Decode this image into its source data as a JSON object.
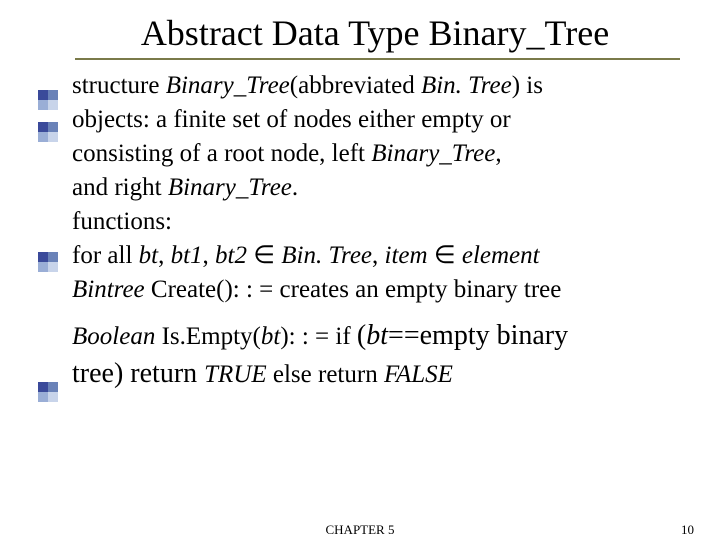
{
  "title": "Abstract Data Type Binary_Tree",
  "lines": {
    "l1a": "structure ",
    "l1b": "Binary_Tree",
    "l1c": "(abbreviated ",
    "l1d": "Bin. Tree",
    "l1e": ") is",
    "l2": "objects: a finite set of nodes either empty or",
    "l3a": "consisting of a root node, left ",
    "l3b": "Binary_Tree",
    "l3c": ",",
    "l4a": "and right ",
    "l4b": "Binary_Tree",
    "l4c": ".",
    "l5": "functions:",
    "l6a": "for all ",
    "l6b": "bt",
    "l6c": ", ",
    "l6d": "bt1",
    "l6e": ", ",
    "l6f": "bt2",
    "l6g": " ∈ ",
    "l6h": "Bin. Tree",
    "l6i": ", ",
    "l6j": "item",
    "l6k": " ∈ ",
    "l6l": "element",
    "l7a": "Bintree ",
    "l7b": "Create(): : = creates an empty binary tree",
    "l8a": "Boolean ",
    "l8b": "Is.Empty(",
    "l8c": "bt",
    "l8d": "): : = if ",
    "l8e": "(",
    "l8f": "bt",
    "l8g": "==empty binary",
    "l9a": "tree) return ",
    "l9b": "TRUE",
    "l9c": " else return ",
    "l9d": "FALSE"
  },
  "footer": {
    "chapter": "CHAPTER 5",
    "page": "10"
  }
}
